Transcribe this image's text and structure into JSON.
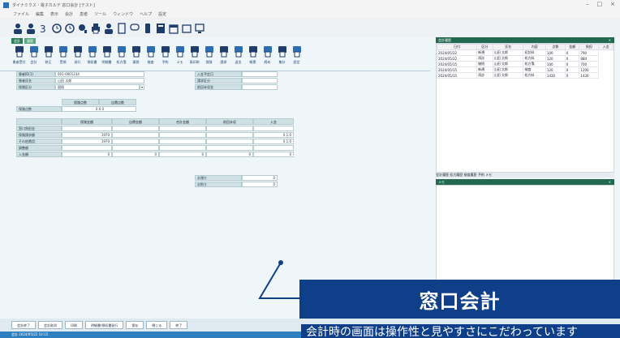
{
  "window": {
    "title": "ダイナミクス・電子カルテ 窓口会計 [テスト]",
    "controls": [
      "–",
      "□",
      "×"
    ]
  },
  "menubar": [
    "ファイル",
    "編集",
    "表示",
    "会計",
    "患者",
    "ツール",
    "ウィンドウ",
    "ヘルプ",
    "設定"
  ],
  "tabs": [
    "会計",
    "履歴"
  ],
  "toolbar": {
    "tools": [
      {
        "label": "患者受付"
      },
      {
        "label": "会計"
      },
      {
        "label": "修正"
      },
      {
        "label": "受領"
      },
      {
        "label": "発行"
      },
      {
        "label": "領収書"
      },
      {
        "label": "明細書"
      },
      {
        "label": "処方箋"
      },
      {
        "label": "薬袋"
      },
      {
        "label": "検査"
      },
      {
        "label": "予約"
      },
      {
        "label": "メモ"
      },
      {
        "label": "再印刷"
      },
      {
        "label": "保険"
      },
      {
        "label": "請求"
      },
      {
        "label": "返金"
      },
      {
        "label": "帳票"
      },
      {
        "label": "締め"
      },
      {
        "label": "集計"
      },
      {
        "label": "設定"
      }
    ]
  },
  "form": {
    "patient_id_label": "患者ID(1)",
    "patient_id_value": "001-0001234",
    "patient_name_label": "患者氏名",
    "patient_name_value": "山田 太郎",
    "insurance_label": "保険区分",
    "insurance_value": "国保",
    "right_fields": [
      {
        "label": "入金予定日",
        "value": ""
      },
      {
        "label": "請求区分",
        "value": ""
      },
      {
        "label": "前回未収金",
        "value": ""
      }
    ],
    "section2": {
      "label": "保険点数",
      "header": [
        "保険点数",
        "自費点数"
      ],
      "value": "0.0.0"
    },
    "grid": {
      "columns": [
        "",
        "保険金額",
        "自費金額",
        "合計金額",
        "前回未収",
        "入金"
      ],
      "rows": [
        {
          "label": "窓口負担金",
          "v1": "",
          "v5": ""
        },
        {
          "label": "保険請求額",
          "v1": "1970",
          "v5": "0.1.0"
        },
        {
          "label": "その他費用",
          "v1": "1970",
          "v5": "0.1.0"
        },
        {
          "label": "調整額",
          "v1": "",
          "v5": ""
        },
        {
          "label": "入金額",
          "v1": "0",
          "v2": "0",
          "v3": "0",
          "v4": "0",
          "v5": "0"
        }
      ]
    },
    "payment": [
      {
        "label": "お預り",
        "value": "0"
      },
      {
        "label": "お釣り",
        "value": "0"
      }
    ]
  },
  "history": {
    "title": "会計履歴",
    "columns": [
      "日付",
      "区分",
      "氏名",
      "内容",
      "点数",
      "金額",
      "負担",
      "入金"
    ],
    "rows": [
      [
        "2024/05/22",
        "新規",
        "山田 太郎",
        "初診料",
        "100",
        "0",
        "790"
      ],
      [
        "2024/05/22",
        "再診",
        "山田 太郎",
        "処方料",
        "120",
        "0",
        "880"
      ],
      [
        "2024/05/15",
        "継続",
        "山田 太郎",
        "処方箋",
        "100",
        "0",
        "700"
      ],
      [
        "2024/05/15",
        "新規",
        "山田 太郎",
        "検査",
        "120",
        "0",
        "1200"
      ],
      [
        "2024/05/15",
        "再診",
        "山田 太郎",
        "処方料",
        "1430",
        "0",
        "1430"
      ]
    ],
    "tab_strip": "会計履歴 処方履歴 検査履歴 予約 メモ"
  },
  "memo": {
    "title": "メモ"
  },
  "bottom_buttons": [
    "会計終了",
    "会計取消",
    "印刷",
    "明細書/領収書発行",
    "保存",
    "閉じる",
    "終了"
  ],
  "status_bar": "会計 2024/05/22 10:15",
  "overlay": {
    "title": "窓口会計",
    "caption": "会計時の画面は操作性と見やすさにこだわっています"
  }
}
